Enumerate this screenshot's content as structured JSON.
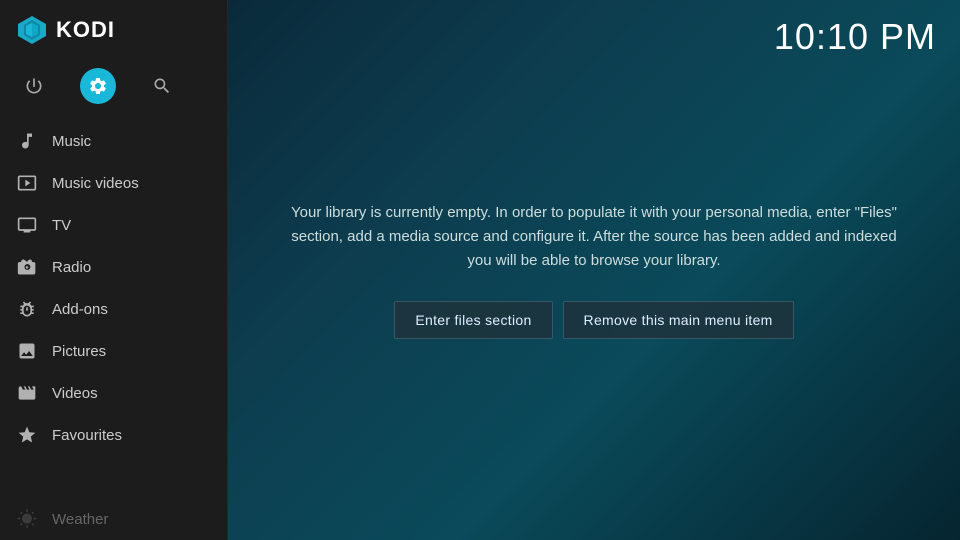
{
  "app": {
    "name": "KODI",
    "clock": "10:10 PM"
  },
  "sidebar": {
    "icons": [
      {
        "name": "power",
        "label": "Power",
        "active": false
      },
      {
        "name": "settings",
        "label": "Settings",
        "active": true
      },
      {
        "name": "search",
        "label": "Search",
        "active": false
      }
    ],
    "nav_items": [
      {
        "id": "music",
        "label": "Music"
      },
      {
        "id": "music-videos",
        "label": "Music videos"
      },
      {
        "id": "tv",
        "label": "TV"
      },
      {
        "id": "radio",
        "label": "Radio"
      },
      {
        "id": "add-ons",
        "label": "Add-ons"
      },
      {
        "id": "pictures",
        "label": "Pictures"
      },
      {
        "id": "videos",
        "label": "Videos"
      },
      {
        "id": "favourites",
        "label": "Favourites"
      },
      {
        "id": "weather",
        "label": "Weather",
        "dimmed": true
      }
    ]
  },
  "main": {
    "info_text": "Your library is currently empty. In order to populate it with your personal media, enter \"Files\" section, add a media source and configure it. After the source has been added and indexed you will be able to browse your library.",
    "buttons": [
      {
        "id": "enter-files",
        "label": "Enter files section"
      },
      {
        "id": "remove-item",
        "label": "Remove this main menu item"
      }
    ]
  }
}
